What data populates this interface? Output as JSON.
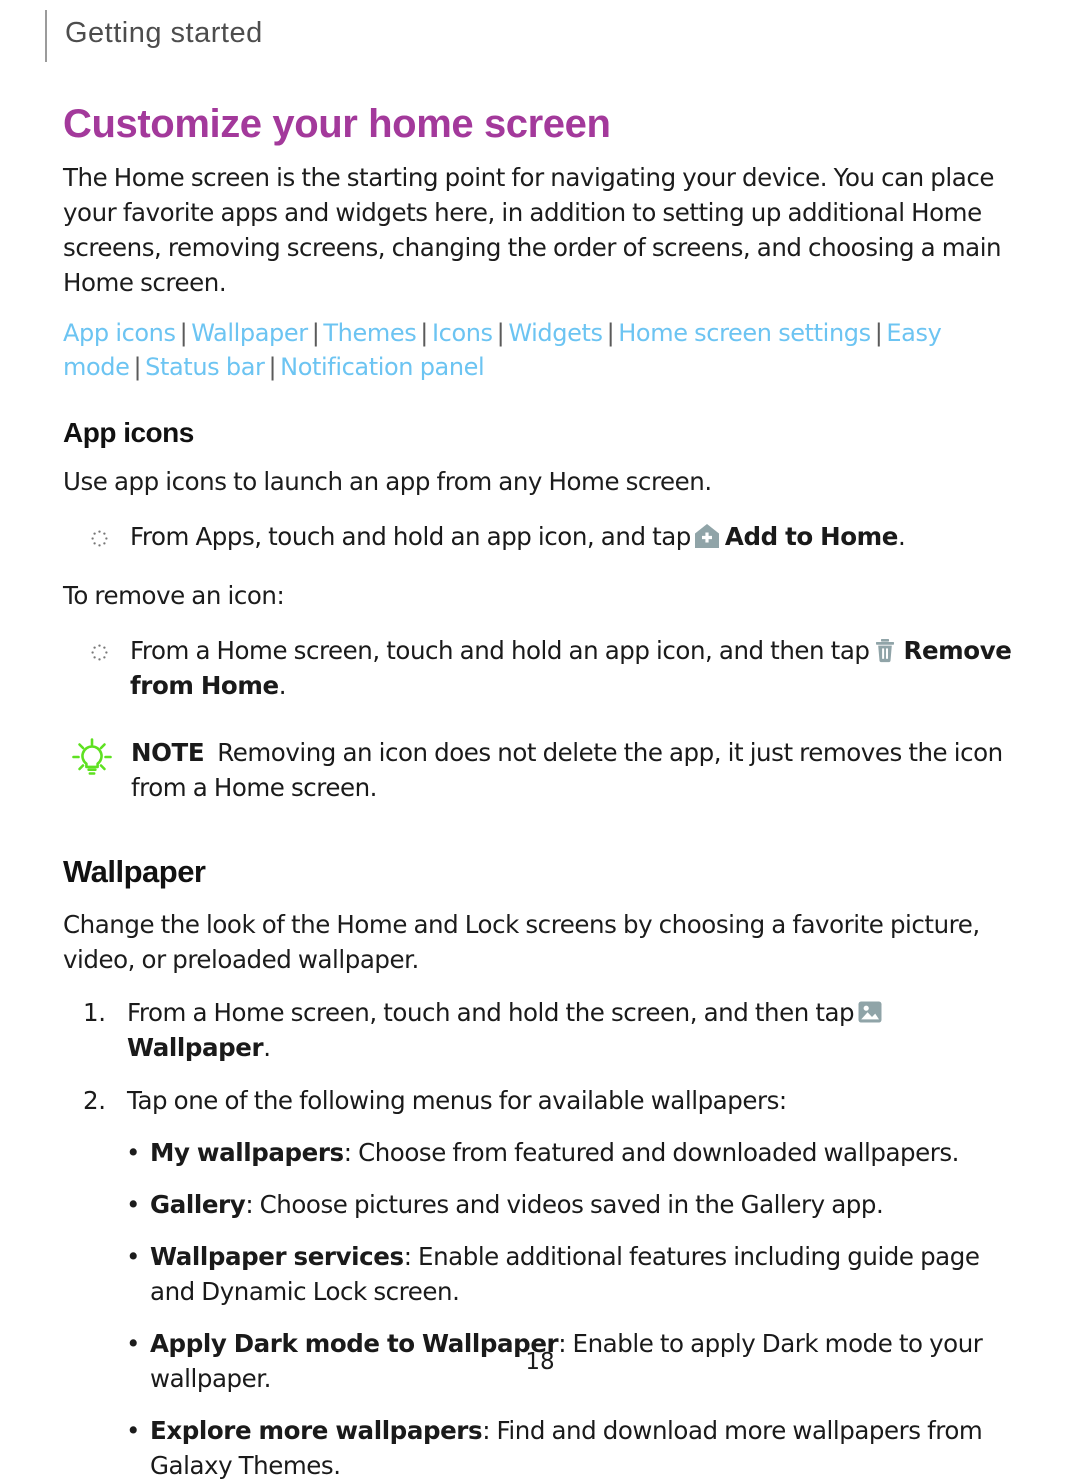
{
  "header": {
    "running_title": "Getting started"
  },
  "chapter": {
    "title": "Customize your home screen"
  },
  "intro": {
    "paragraph": "The Home screen is the starting point for navigating your device. You can place your favorite apps and widgets here, in addition to setting up additional Home screens, removing screens, changing the order of screens, and choosing a main Home screen."
  },
  "linkbar": {
    "separator": "|",
    "links": [
      "App icons",
      "Wallpaper",
      "Themes",
      "Icons",
      "Widgets",
      "Home screen settings",
      "Easy mode",
      "Status bar",
      "Notification panel"
    ]
  },
  "app_icons": {
    "heading": "App icons",
    "intro": "Use app icons to launch an app from any Home screen.",
    "step_add_pre": "From Apps, touch and hold an app icon, and tap",
    "step_add_icon": "add-to-home-icon",
    "step_add_bold": "Add to Home",
    "step_add_post": ".",
    "remove_intro": "To remove an icon:",
    "step_remove_pre": "From a Home screen, touch and hold an app icon, and then tap",
    "step_remove_icon": "remove-from-home-trash-icon",
    "step_remove_bold": "Remove from Home",
    "step_remove_post": ".",
    "note_label": "NOTE",
    "note_body": "Removing an icon does not delete the app, it just removes the icon from a Home screen."
  },
  "wallpaper": {
    "heading": "Wallpaper",
    "intro": "Change the look of the Home and Lock screens by choosing a favorite picture, video, or preloaded wallpaper.",
    "steps": [
      {
        "number": "1.",
        "pre": "From a Home screen, touch and hold the screen, and then tap",
        "icon": "wallpaper-picture-icon",
        "bold": "Wallpaper",
        "post": "."
      },
      {
        "number": "2.",
        "pre": "Tap one of the following menus for available wallpapers:",
        "icon": "",
        "bold": "",
        "post": ""
      }
    ],
    "bullet_char": "•",
    "options": [
      {
        "term": "My wallpapers",
        "desc": ": Choose from featured and downloaded wallpapers."
      },
      {
        "term": "Gallery",
        "desc": ": Choose pictures and videos saved in the Gallery app."
      },
      {
        "term": "Wallpaper services",
        "desc": ": Enable additional features including guide page and Dynamic Lock screen."
      },
      {
        "term": "Apply Dark mode to Wallpaper",
        "desc": ": Enable to apply Dark mode to your wallpaper."
      },
      {
        "term": "Explore more wallpapers",
        "desc": ": Find and download more wallpapers from Galaxy Themes."
      }
    ]
  },
  "footer": {
    "page_number": "18"
  },
  "colors": {
    "chapter_title": "#a3399b",
    "link": "#6cc4f2",
    "separator": "#5a5a5a",
    "icon_gray_blue": "#90a4a8",
    "note_green": "#5ee121",
    "body_text": "#1c1c1c",
    "running_title": "#4d4d4d"
  }
}
